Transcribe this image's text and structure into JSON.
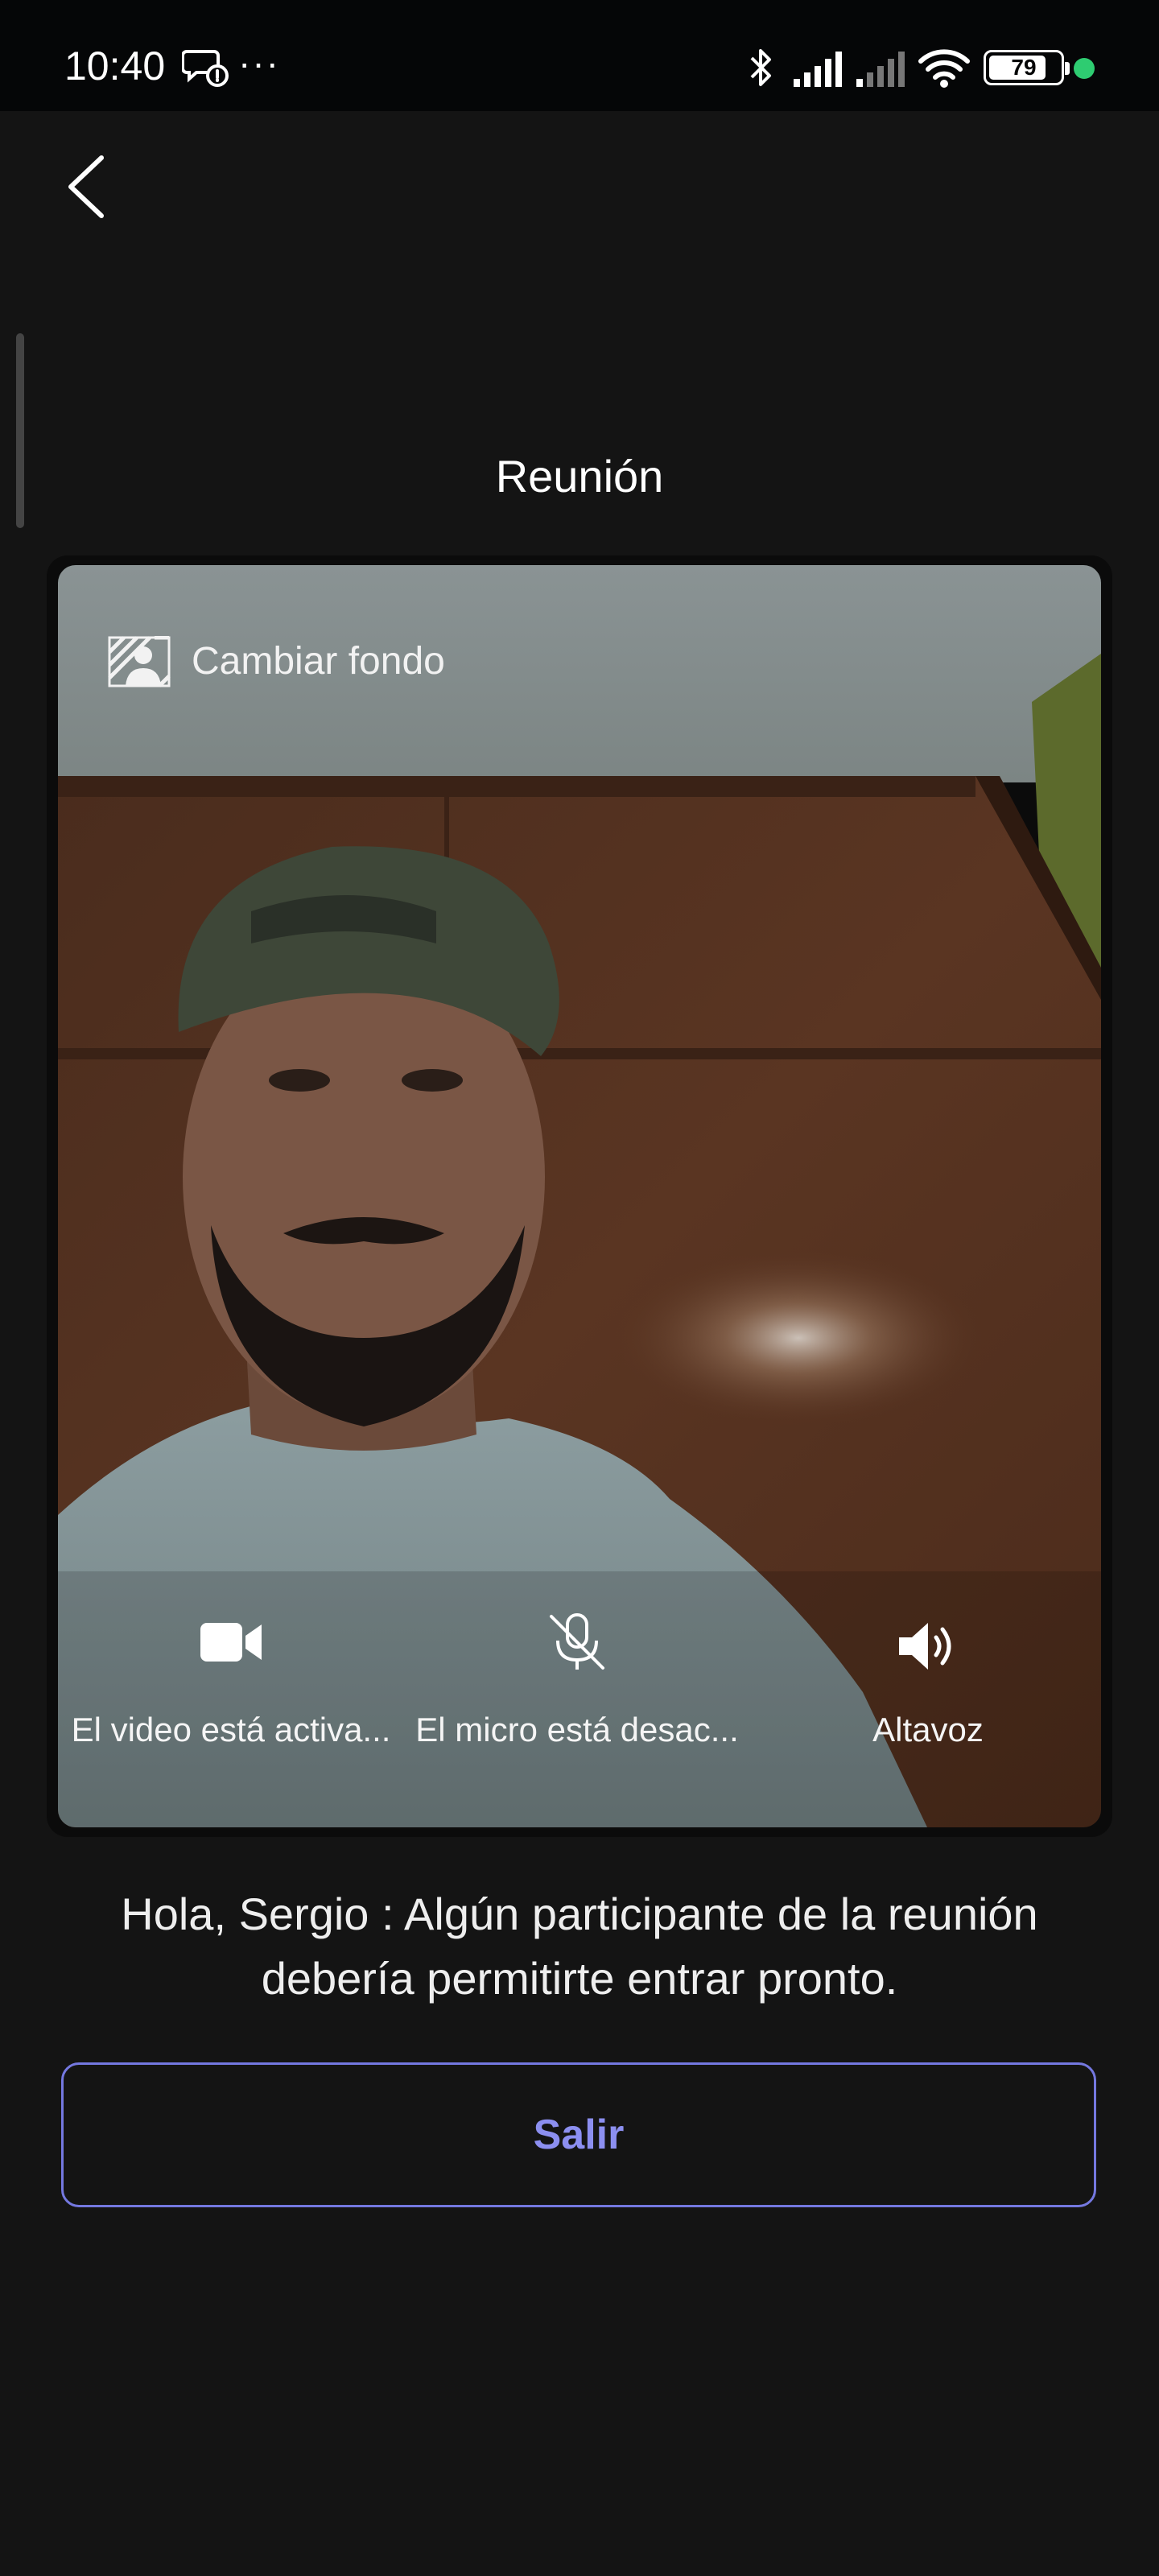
{
  "status_bar": {
    "time": "10:40",
    "more": "···",
    "battery_level": "79",
    "notification_icon": "chat-notification-icon",
    "icons": [
      "bluetooth-icon",
      "signal-strength-icon",
      "signal-strength-weak-icon",
      "wifi-icon",
      "battery-icon"
    ],
    "active_dot_color": "#2ecc71"
  },
  "nav": {
    "back_icon": "chevron-left-icon"
  },
  "page": {
    "title": "Reunión"
  },
  "preview": {
    "change_background_label": "Cambiar fondo",
    "change_background_icon": "background-effects-icon",
    "controls": [
      {
        "icon": "video-camera-icon",
        "label": "El video está activa..."
      },
      {
        "icon": "microphone-off-icon",
        "label": "El micro está desac..."
      },
      {
        "icon": "speaker-icon",
        "label": "Altavoz"
      }
    ]
  },
  "waiting": {
    "message": "Hola, Sergio : Algún participante de la reunión debería permitirte entrar pronto."
  },
  "actions": {
    "exit_label": "Salir"
  },
  "colors": {
    "background": "#141414",
    "accent": "#8c8ff0",
    "accent_border": "#7478e0"
  }
}
